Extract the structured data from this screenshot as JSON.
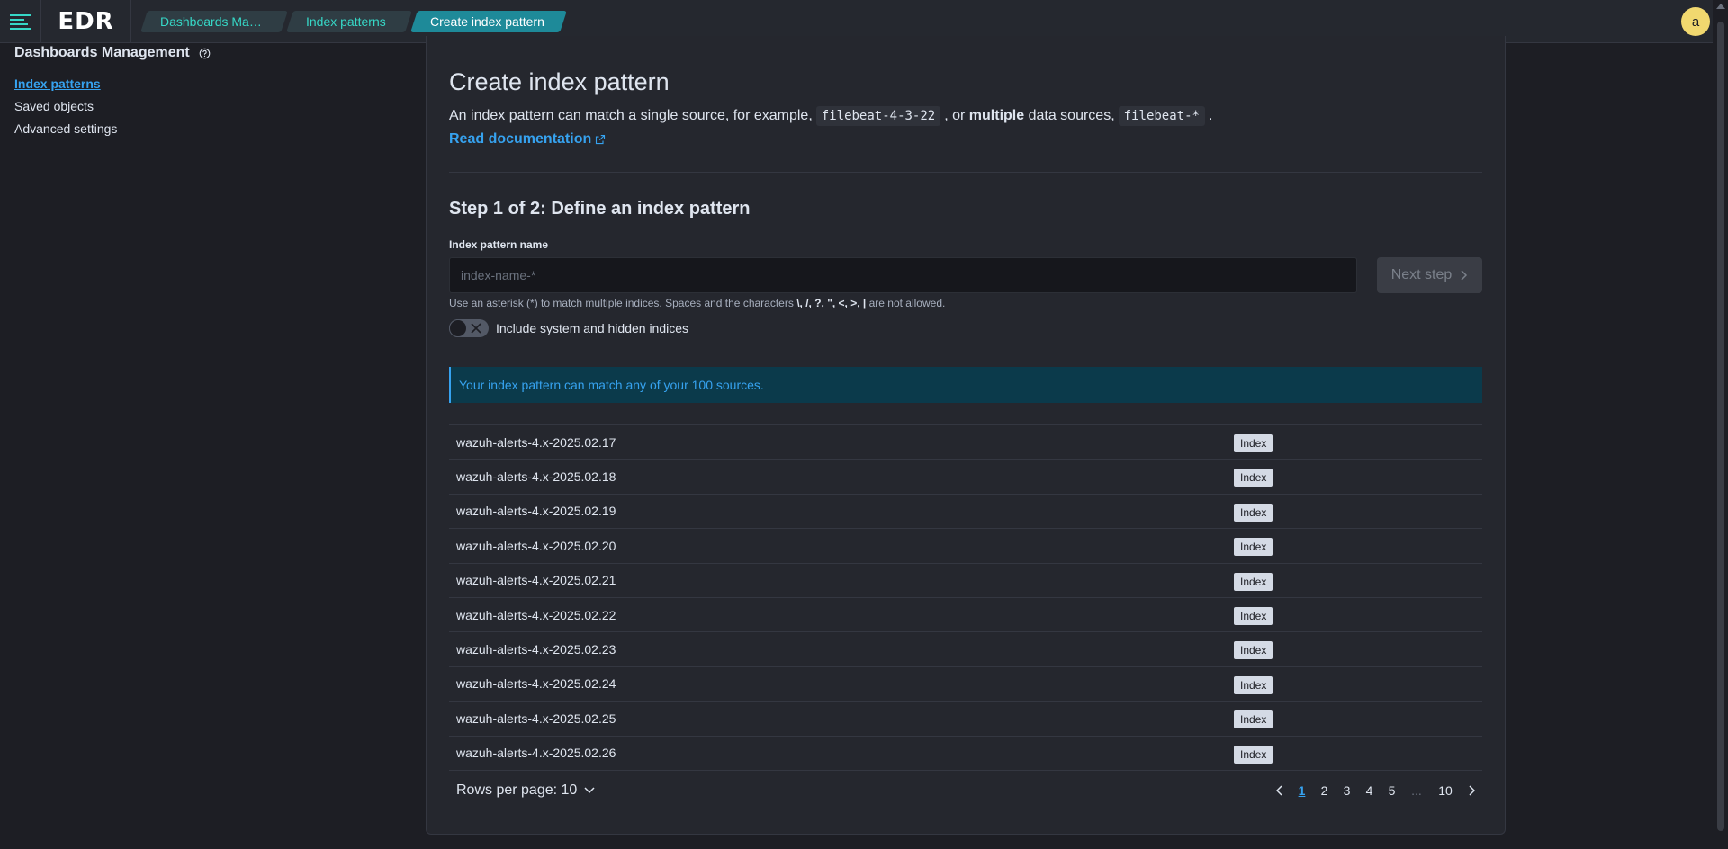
{
  "header": {
    "logo_text": "EDR",
    "breadcrumbs": [
      "Dashboards Man...",
      "Index patterns",
      "Create index pattern"
    ],
    "avatar_letter": "a",
    "accent_color": "#36d8c7"
  },
  "sidebar": {
    "title": "Dashboards Management",
    "items": [
      {
        "label": "Index patterns",
        "active": true
      },
      {
        "label": "Saved objects",
        "active": false
      },
      {
        "label": "Advanced settings",
        "active": false
      }
    ]
  },
  "main": {
    "title": "Create index pattern",
    "description": {
      "part1": "An index pattern can match a single source, for example,",
      "code1": "filebeat-4-3-22",
      "part2": ", or",
      "bold": "multiple",
      "part3": "data sources,",
      "code2": "filebeat-*",
      "part4": "."
    },
    "doc_link": "Read documentation",
    "step_title": "Step 1 of 2: Define an index pattern",
    "field_label": "Index pattern name",
    "input_placeholder": "index-name-*",
    "input_value": "",
    "next_button": "Next step",
    "help_text": {
      "prefix": "Use an asterisk (*) to match multiple indices. Spaces and the characters",
      "chars": "\\, /, ?, \", <, >, |",
      "suffix": "are not allowed."
    },
    "toggle_label": "Include system and hidden indices",
    "toggle_on": false,
    "callout": "Your index pattern can match any of your 100 sources.",
    "rows": [
      {
        "name": "wazuh-alerts-4.x-2025.02.17",
        "tag": "Index"
      },
      {
        "name": "wazuh-alerts-4.x-2025.02.18",
        "tag": "Index"
      },
      {
        "name": "wazuh-alerts-4.x-2025.02.19",
        "tag": "Index"
      },
      {
        "name": "wazuh-alerts-4.x-2025.02.20",
        "tag": "Index"
      },
      {
        "name": "wazuh-alerts-4.x-2025.02.21",
        "tag": "Index"
      },
      {
        "name": "wazuh-alerts-4.x-2025.02.22",
        "tag": "Index"
      },
      {
        "name": "wazuh-alerts-4.x-2025.02.23",
        "tag": "Index"
      },
      {
        "name": "wazuh-alerts-4.x-2025.02.24",
        "tag": "Index"
      },
      {
        "name": "wazuh-alerts-4.x-2025.02.25",
        "tag": "Index"
      },
      {
        "name": "wazuh-alerts-4.x-2025.02.26",
        "tag": "Index"
      }
    ],
    "rows_per_page": "Rows per page: 10",
    "pagination": {
      "pages": [
        "1",
        "2",
        "3",
        "4",
        "5"
      ],
      "ellipsis": "...",
      "last_page": "10",
      "current": "1"
    }
  }
}
